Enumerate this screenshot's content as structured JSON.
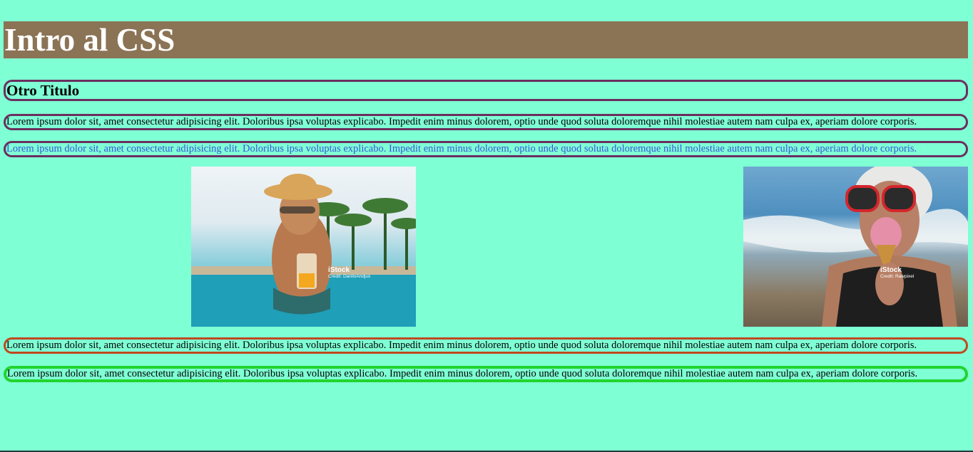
{
  "page": {
    "heading": "Intro al CSS",
    "subheading": "Otro Titulo",
    "paragraphs": [
      "Lorem ipsum dolor sit, amet consectetur adipisicing elit. Doloribus ipsa voluptas explicabo. Impedit enim minus dolorem, optio unde quod soluta doloremque nihil molestiae autem nam culpa ex, aperiam dolore corporis.",
      "Lorem ipsum dolor sit, amet consectetur adipisicing elit. Doloribus ipsa voluptas explicabo. Impedit enim minus dolorem, optio unde quod soluta doloremque nihil molestiae autem nam culpa ex, aperiam dolore corporis.",
      "Lorem ipsum dolor sit, amet consectetur adipisicing elit. Doloribus ipsa voluptas explicabo. Impedit enim minus dolorem, optio unde quod soluta doloremque nihil molestiae autem nam culpa ex, aperiam dolore corporis.",
      "Lorem ipsum dolor sit, amet consectetur adipisicing elit. Doloribus ipsa voluptas explicabo. Impedit enim minus dolorem, optio unde quod soluta doloremque nihil molestiae autem nam culpa ex, aperiam dolore corporis."
    ],
    "images": [
      {
        "watermark_brand": "iStock",
        "watermark_credit": "Credit: DaniloAndjus"
      },
      {
        "watermark_brand": "iStock",
        "watermark_credit": "Credit: Rawpixel"
      }
    ]
  },
  "colors": {
    "background": "#7fffd4",
    "heading_bg": "#8b7355",
    "border_purple": "#6b2e5f",
    "link_blue": "#3b55d9",
    "border_orange": "#c0481f",
    "border_green": "#22d42e"
  }
}
